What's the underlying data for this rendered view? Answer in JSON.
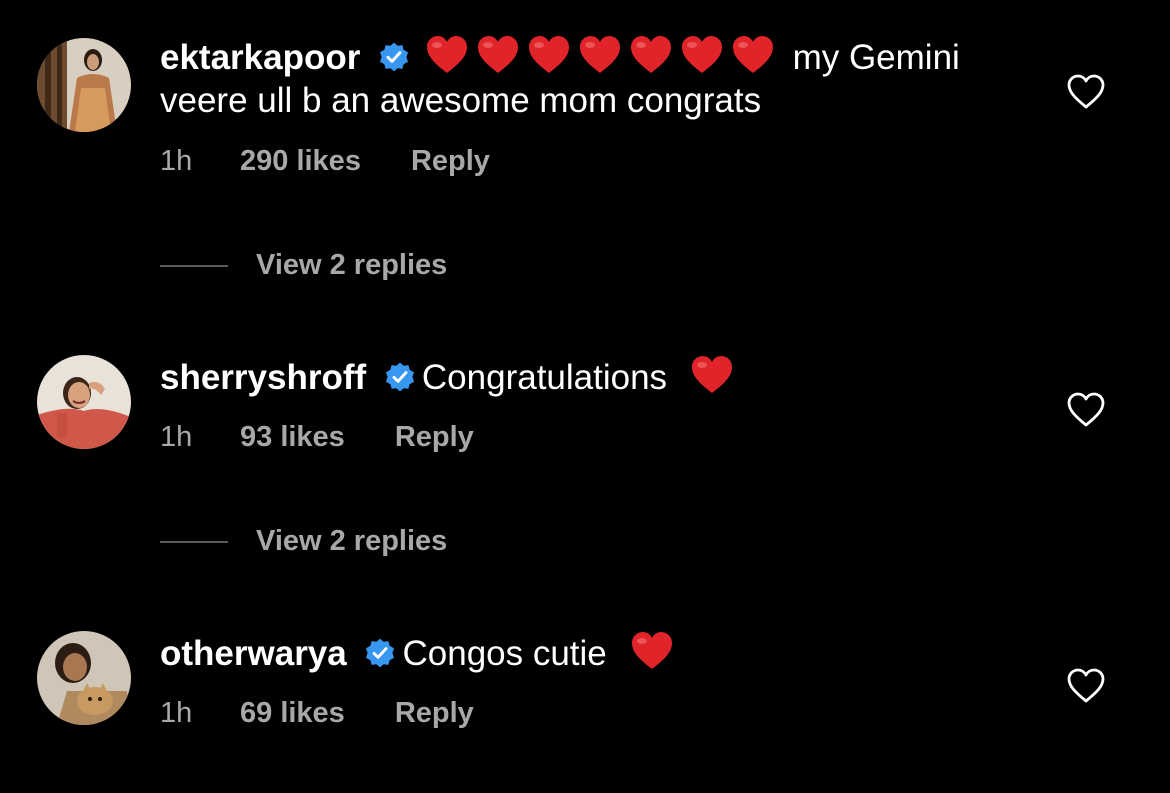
{
  "comments": [
    {
      "username": "ektarkapoor",
      "heart_count": 7,
      "text": " my Gemini veere ull b an awesome mom congrats",
      "time": "1h",
      "likes": "290 likes",
      "reply_label": "Reply",
      "view_replies": "View 2 replies"
    },
    {
      "username": "sherryshroff",
      "heart_count": 0,
      "text": "Congratulations",
      "trailing_heart": true,
      "time": "1h",
      "likes": "93 likes",
      "reply_label": "Reply",
      "view_replies": "View 2 replies"
    },
    {
      "username": "otherwarya",
      "heart_count": 0,
      "text": "Congos cutie",
      "trailing_heart": true,
      "time": "1h",
      "likes": "69 likes",
      "reply_label": "Reply"
    }
  ],
  "colors": {
    "background": "#000000",
    "text": "#ffffff",
    "secondary": "#a8a8a8",
    "verified": "#3897f0",
    "heart_emoji": "#e0242a"
  },
  "icons": {
    "verified": "verified-badge-icon",
    "like": "heart-outline-icon",
    "emoji": "red-heart-emoji-icon"
  }
}
